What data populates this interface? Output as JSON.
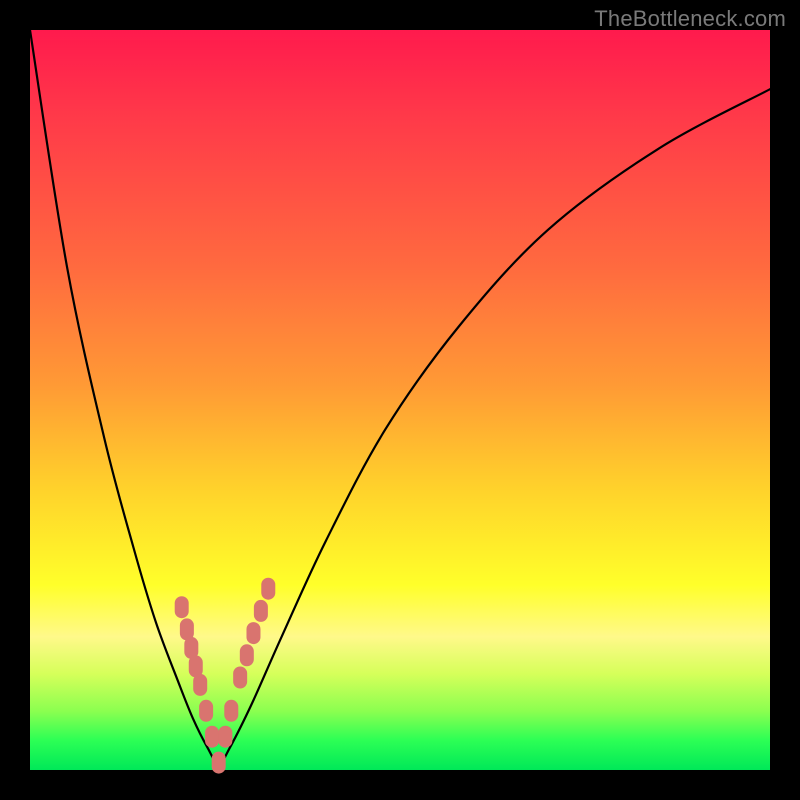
{
  "watermark": "TheBottleneck.com",
  "chart_data": {
    "type": "line",
    "title": "",
    "xlabel": "",
    "ylabel": "",
    "xlim": [
      0,
      100
    ],
    "ylim": [
      0,
      100
    ],
    "series": [
      {
        "name": "curve",
        "x": [
          0,
          5,
          10,
          14,
          17,
          20,
          22,
          24,
          25.5,
          27,
          30,
          34,
          40,
          48,
          58,
          70,
          85,
          100
        ],
        "y": [
          100,
          68,
          45,
          30,
          20,
          12,
          7,
          3,
          0.8,
          3,
          9,
          18,
          31,
          46,
          60,
          73,
          84,
          92
        ]
      }
    ],
    "markers": {
      "name": "highlight-points",
      "color": "#d9746f",
      "x": [
        20.5,
        21.2,
        21.8,
        22.4,
        23.0,
        23.8,
        24.6,
        25.5,
        26.4,
        27.2,
        28.4,
        29.3,
        30.2,
        31.2,
        32.2
      ],
      "y": [
        22.0,
        19.0,
        16.5,
        14.0,
        11.5,
        8.0,
        4.5,
        1.0,
        4.5,
        8.0,
        12.5,
        15.5,
        18.5,
        21.5,
        24.5
      ]
    }
  }
}
